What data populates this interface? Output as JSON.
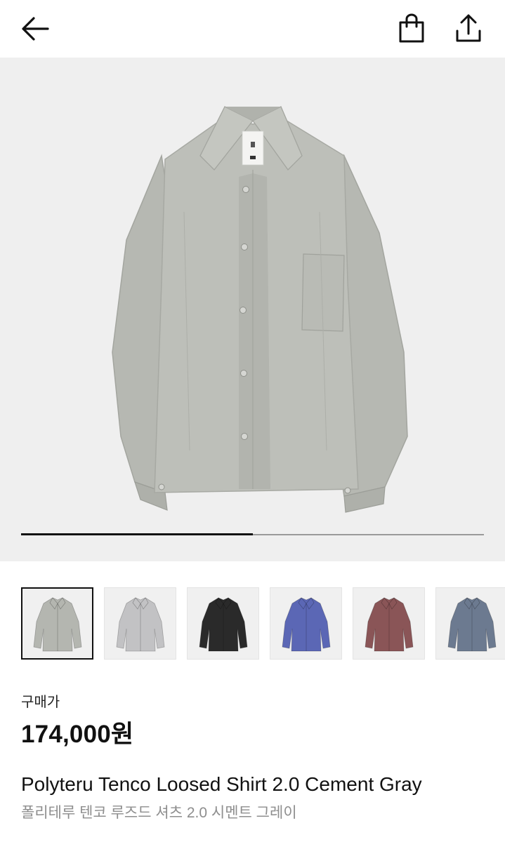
{
  "header": {
    "back_icon": "arrow-left-icon",
    "bag_icon": "shopping-bag-icon",
    "share_icon": "share-upload-icon"
  },
  "gallery": {
    "background": "#efefef",
    "progress": 0.5,
    "main_shirt_color": "#b9bbb5"
  },
  "thumbnails": [
    {
      "color": "Cement Gray",
      "hex": "#b4b6b0",
      "selected": true
    },
    {
      "color": "Light Gray",
      "hex": "#c2c2c4",
      "selected": false
    },
    {
      "color": "Black",
      "hex": "#2a2a2a",
      "selected": false
    },
    {
      "color": "Blue",
      "hex": "#5b67b5",
      "selected": false
    },
    {
      "color": "Burgundy",
      "hex": "#8a5557",
      "selected": false
    },
    {
      "color": "Slate",
      "hex": "#6c7a90",
      "selected": false
    }
  ],
  "price": {
    "label": "구매가",
    "value": "174,000원"
  },
  "product": {
    "title_en": "Polyteru Tenco Loosed Shirt 2.0 Cement Gray",
    "title_ko": "폴리테루 텐코 루즈드 셔츠 2.0 시멘트 그레이"
  }
}
